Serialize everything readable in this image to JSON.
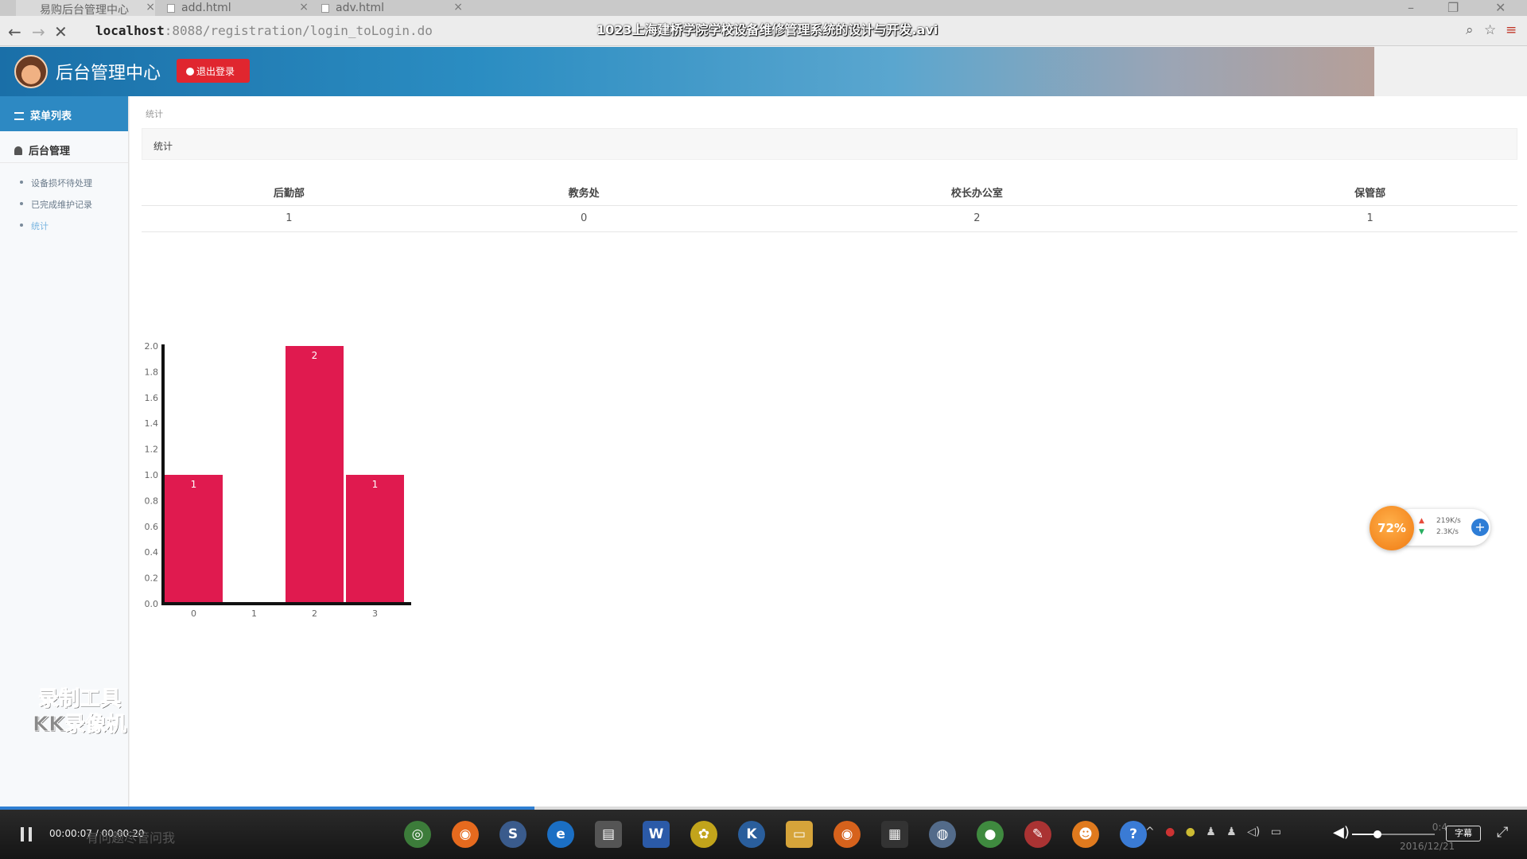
{
  "browser": {
    "tabs": [
      {
        "label": "易购后台管理中心"
      },
      {
        "label": "add.html"
      },
      {
        "label": "adv.html"
      }
    ],
    "url_host": "localhost",
    "url_rest": ":8088/registration/login_toLogin.do",
    "video_title": "1023上海建桥学院学校设备维修管理系统的设计与开发.avi"
  },
  "header": {
    "title": "后台管理中心",
    "logout_label": "退出登录"
  },
  "sidebar": {
    "menu_title": "菜单列表",
    "section_title": "后台管理",
    "items": [
      {
        "label": "设备损坏待处理"
      },
      {
        "label": "已完成维护记录"
      },
      {
        "label": "统计"
      }
    ]
  },
  "watermark": {
    "line1": "录制工具",
    "line2": "KK录像机"
  },
  "main": {
    "breadcrumb": "统计",
    "panel_title": "统计",
    "table": {
      "headers": [
        "后勤部",
        "教务处",
        "校长办公室",
        "保管部"
      ],
      "values": [
        "1",
        "0",
        "2",
        "1"
      ]
    }
  },
  "chart_data": {
    "type": "bar",
    "categories": [
      "0",
      "1",
      "2",
      "3"
    ],
    "values": [
      1,
      0,
      2,
      1
    ],
    "data_labels": [
      "1",
      "",
      "2",
      "1"
    ],
    "ylim": [
      0,
      2.0
    ],
    "yticks": [
      "0.0",
      "0.2",
      "0.4",
      "0.6",
      "0.8",
      "1.0",
      "1.2",
      "1.4",
      "1.6",
      "1.8",
      "2.0"
    ],
    "bar_color": "#e01a4f",
    "grid": false,
    "title": "",
    "xlabel": "",
    "ylabel": ""
  },
  "net_widget": {
    "percent": "72%",
    "up": "219K/s",
    "down": "2.3K/s"
  },
  "player": {
    "time": "00:00:07 / 00:00:20",
    "search_placeholder": "有问题尽管问我",
    "progress": 0.35,
    "volume": 0.3,
    "clock_time": "0:4",
    "clock_date": "2016/12/21",
    "subtitle_label": "字幕"
  },
  "colors": {
    "accent": "#2d89c3",
    "logout": "#e0262f",
    "bar": "#e01a4f"
  }
}
